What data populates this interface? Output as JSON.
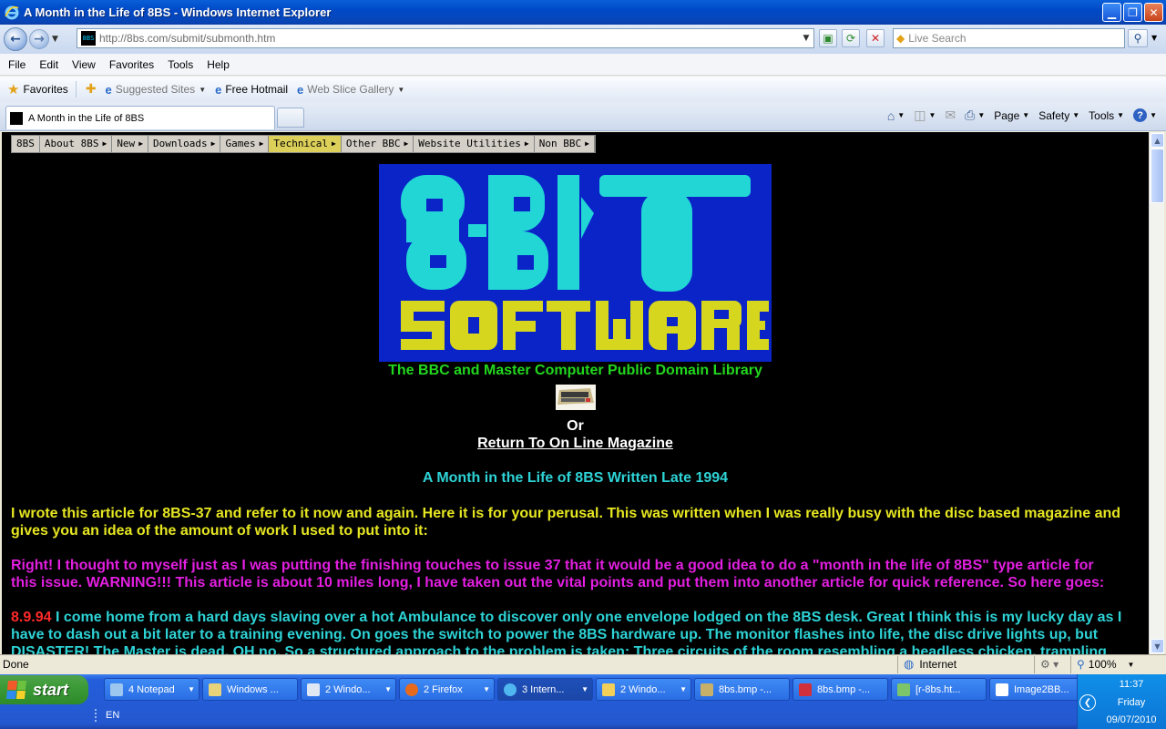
{
  "window": {
    "title": "A Month in the Life of 8BS - Windows Internet Explorer",
    "controls": [
      "minimize",
      "maximize",
      "close"
    ]
  },
  "address_bar": {
    "url": "http://8bs.com/submit/submonth.htm",
    "search_placeholder": "Live Search"
  },
  "menu": [
    "File",
    "Edit",
    "View",
    "Favorites",
    "Tools",
    "Help"
  ],
  "favorites_bar": {
    "favorites_label": "Favorites",
    "links": [
      "Suggested Sites",
      "Free Hotmail",
      "Web Slice Gallery"
    ]
  },
  "tabs": [
    {
      "label": "A Month in the Life of 8BS"
    }
  ],
  "command_bar": {
    "page": "Page",
    "safety": "Safety",
    "tools": "Tools"
  },
  "site_nav": {
    "items": [
      "8BS",
      "About 8BS",
      "New",
      "Downloads",
      "Games",
      "Technical",
      "Other BBC",
      "Website Utilities",
      "Non BBC"
    ],
    "active": "Technical"
  },
  "page": {
    "tagline": "The BBC and Master Computer Public Domain Library",
    "or": "Or",
    "return_link": "Return To On Line Magazine",
    "heading": "A Month in the Life of 8BS Written Late 1994",
    "p1": "I wrote this article for 8BS-37 and refer to it now and again. Here it is for your perusal. This was written when I was really busy with the disc based magazine and gives you an idea of the amount of work I used to put into it:",
    "p2": "Right! I thought to myself just as I was putting the finishing touches to issue 37 that it would be a good idea to do a \"month in the life of 8BS\" type article for this issue. WARNING!!! This article is about 10 miles long, I have taken out the vital points and put them into another article for quick reference. So here goes:",
    "p3_date": "8.9.94",
    "p3": "I come home from a hard days slaving over a hot Ambulance to discover only one envelope lodged on the 8BS desk. Great I think this is my lucky day as I have to dash out a bit later to a training evening. On goes the switch to power the 8BS hardware up. The monitor flashes into life, the disc drive lights up, but DISASTER! The Master is dead. OH no. So a structured approach to the problem is taken: Three circuits of the room resembling a headless chicken, trampling",
    "colors": {
      "tagline": "#22d61e",
      "heading": "#2ed3d6",
      "p1": "#e6e622",
      "p2": "#e21fe0",
      "p3": "#2ed3d6",
      "date": "#ff2a2a",
      "logo_bg": "#0a24c8",
      "logo_8bit": "#22d6d6",
      "logo_software": "#d6d61e"
    }
  },
  "status_bar": {
    "status": "Done",
    "zone": "Internet",
    "zoom": "100%"
  },
  "taskbar": {
    "start": "start",
    "items": [
      {
        "label": "4 Notepad",
        "icon": "notepad-icon",
        "group": true
      },
      {
        "label": "Windows ...",
        "icon": "explorer-icon",
        "group": false
      },
      {
        "label": "2 Windo...",
        "icon": "document-icon",
        "group": true
      },
      {
        "label": "2 Firefox",
        "icon": "firefox-icon",
        "group": true
      },
      {
        "label": "3 Intern...",
        "icon": "ie-icon",
        "group": true,
        "active": true
      },
      {
        "label": "2 Windo...",
        "icon": "folder-icon",
        "group": true
      },
      {
        "label": "8bs.bmp -...",
        "icon": "paint-icon",
        "group": false
      },
      {
        "label": "8bs.bmp -...",
        "icon": "image-icon",
        "group": false
      },
      {
        "label": "[r-8bs.ht...",
        "icon": "editor-icon",
        "group": false
      },
      {
        "label": "Image2BB...",
        "icon": "window-icon",
        "group": false
      }
    ],
    "language": "EN",
    "time": "11:37",
    "day": "Friday",
    "date": "09/07/2010"
  }
}
